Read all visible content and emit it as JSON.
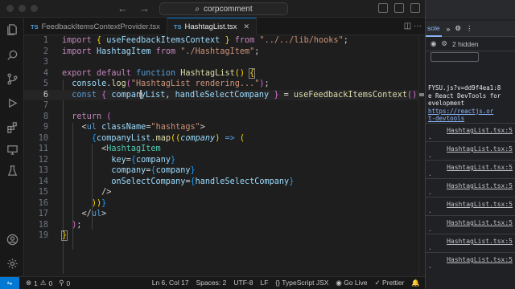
{
  "titlebar": {
    "search_text": "corpcomment"
  },
  "tabs": [
    {
      "lang": "TS",
      "label": "FeedbackItemsContextProvider.tsx",
      "active": false
    },
    {
      "lang": "TS",
      "label": "HashtagList.tsx",
      "active": true
    }
  ],
  "editor": {
    "line_numbers": [
      "1",
      "2",
      "3",
      "4",
      "5",
      "6",
      "7",
      "8",
      "9",
      "10",
      "11",
      "12",
      "13",
      "14",
      "15",
      "16",
      "17",
      "18",
      "19"
    ],
    "current_line": 6
  },
  "statusbar": {
    "errors": "1",
    "warnings": "0",
    "ports": "0",
    "position": "Ln 6, Col 17",
    "indent": "Spaces: 2",
    "encoding": "UTF-8",
    "eol": "LF",
    "language": "TypeScript JSX",
    "go_live": "Go Live",
    "formatter": "Prettier"
  },
  "devtools": {
    "tab_label": "sole",
    "hidden_count": "2 hidden",
    "message_lines": [
      "FYSU.js?v=dd9f4ea1:8",
      "e React DevTools for",
      "evelopment"
    ],
    "message_link_lines": [
      "https://reactjs.or",
      "t-devtools"
    ],
    "log_source": "HashtagList.tsx:5",
    "log_count": 8
  },
  "colors": {
    "accent": "#0078d4",
    "editor_bg": "#1e1e1e",
    "devtools_link": "#8ab4f8"
  }
}
